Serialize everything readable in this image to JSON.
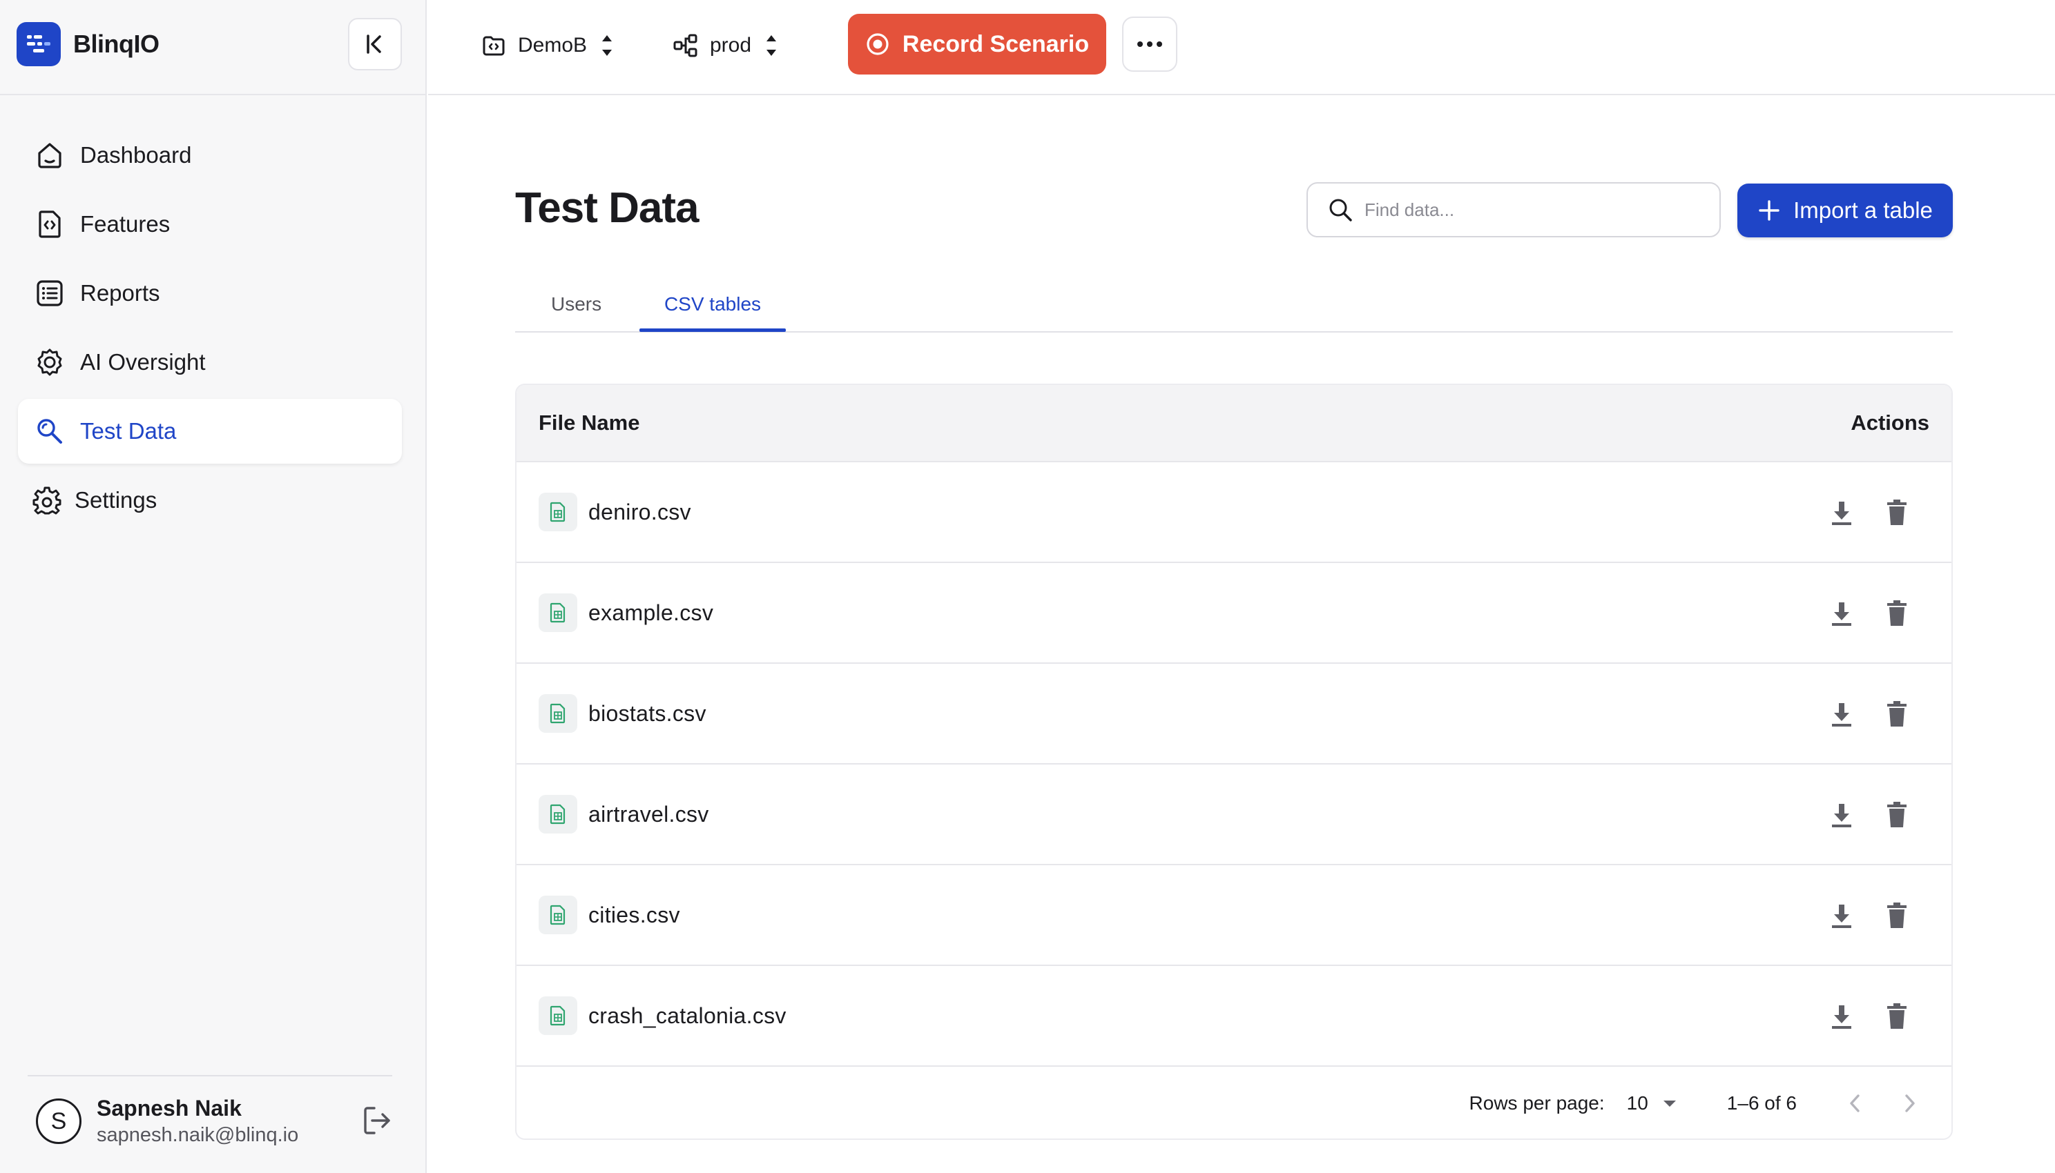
{
  "brand": {
    "name": "BlinqIO",
    "accent": "#1f45c7"
  },
  "sidebar": {
    "items": [
      {
        "label": "Dashboard",
        "icon": "home-icon"
      },
      {
        "label": "Features",
        "icon": "feature-file-icon"
      },
      {
        "label": "Reports",
        "icon": "list-icon"
      },
      {
        "label": "AI Oversight",
        "icon": "cog-chip-icon"
      },
      {
        "label": "Test Data",
        "icon": "search-data-icon",
        "active": true
      },
      {
        "label": "Settings",
        "icon": "gear-icon"
      }
    ],
    "user": {
      "initial": "S",
      "name": "Sapnesh Naik",
      "email": "sapnesh.naik@blinq.io"
    }
  },
  "topbar": {
    "project": "DemoB",
    "environment": "prod",
    "record_label": "Record Scenario",
    "record_color": "#e4523b"
  },
  "main": {
    "title": "Test Data",
    "search": {
      "placeholder": "Find data..."
    },
    "import_label": "Import a table",
    "tabs": [
      {
        "label": "Users"
      },
      {
        "label": "CSV tables",
        "active": true
      }
    ],
    "table": {
      "columns": [
        "File Name",
        "Actions"
      ],
      "rows": [
        {
          "name": "deniro.csv"
        },
        {
          "name": "example.csv"
        },
        {
          "name": "biostats.csv"
        },
        {
          "name": "airtravel.csv"
        },
        {
          "name": "cities.csv"
        },
        {
          "name": "crash_catalonia.csv"
        }
      ],
      "footer": {
        "rows_per_page_label": "Rows per page:",
        "rows_per_page": "10",
        "range": "1–6 of 6"
      }
    }
  }
}
